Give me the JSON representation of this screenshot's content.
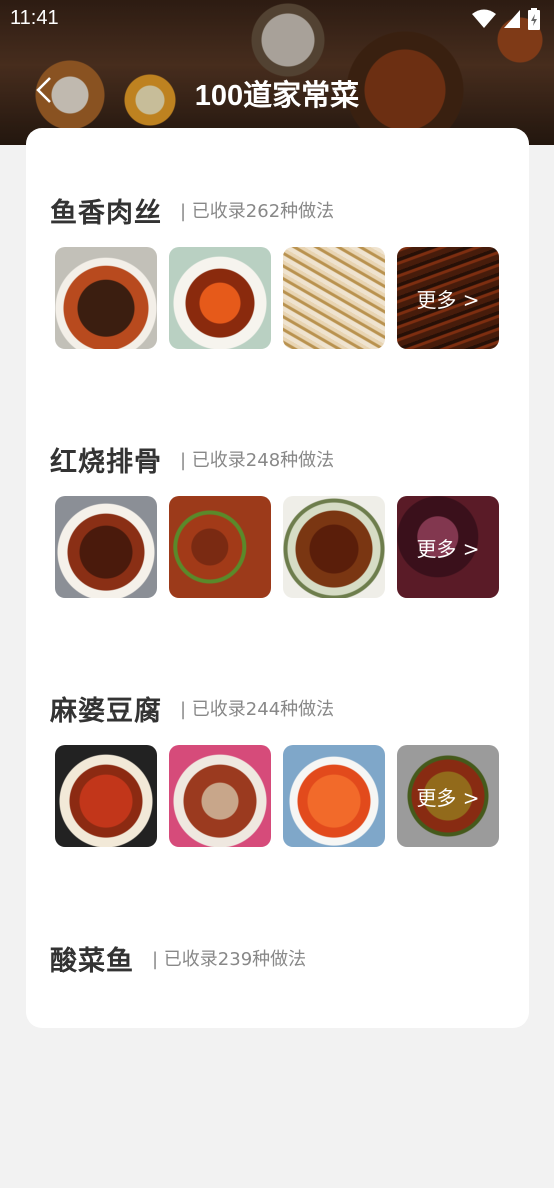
{
  "status": {
    "time": "11:41"
  },
  "nav": {
    "title": "100道家常菜"
  },
  "sections": [
    {
      "title": "鱼香肉丝",
      "count": "| 已收录262种做法",
      "more": "更多 >"
    },
    {
      "title": "红烧排骨",
      "count": "| 已收录248种做法",
      "more": "更多 >"
    },
    {
      "title": "麻婆豆腐",
      "count": "| 已收录244种做法",
      "more": "更多 >"
    },
    {
      "title": "酸菜鱼",
      "count": "| 已收录239种做法",
      "more": ""
    }
  ],
  "colors": {
    "title": "#333333",
    "subtitle": "#888888",
    "card": "#ffffff",
    "background": "#f2f2f2"
  },
  "icons": [
    "back-arrow-icon",
    "wifi-icon",
    "signal-icon",
    "battery-icon"
  ]
}
